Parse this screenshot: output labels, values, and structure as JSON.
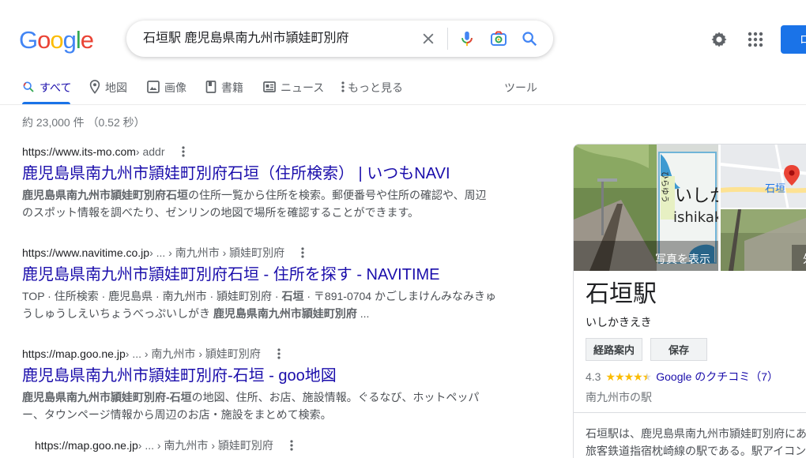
{
  "brand": {
    "logo_letters": [
      "G",
      "o",
      "o",
      "g",
      "l",
      "e"
    ],
    "logo_colors": [
      "#4285F4",
      "#EA4335",
      "#FBBC05",
      "#4285F4",
      "#34A853",
      "#EA4335"
    ]
  },
  "search": {
    "query": "石垣駅 鹿児島県南九州市頴娃町別府",
    "clear_icon": "close-icon",
    "voice_icon": "mic-icon",
    "lens_icon": "camera-icon",
    "search_icon": "search-icon"
  },
  "header": {
    "settings_icon": "gear-icon",
    "apps_icon": "apps-icon",
    "login_label": "ロ"
  },
  "tabs": [
    {
      "label": "すべて",
      "icon": "search-icon",
      "active": true
    },
    {
      "label": "地図",
      "icon": "map-pin-icon"
    },
    {
      "label": "画像",
      "icon": "image-icon"
    },
    {
      "label": "書籍",
      "icon": "book-icon"
    },
    {
      "label": "ニュース",
      "icon": "news-icon"
    },
    {
      "label": "もっと見る",
      "icon": "more-vert-icon"
    },
    {
      "label": "ツール"
    }
  ],
  "stats": "約 23,000 件 （0.52 秒）",
  "results": [
    {
      "url": "https://www.its-mo.com",
      "crumbs": " › addr",
      "title": "鹿児島県南九州市頴娃町別府石垣（住所検索） | いつもNAVI",
      "snippet_bold": "鹿児島県南九州市頴娃町別府石垣",
      "snippet": "の住所一覧から住所を検索。郵便番号や住所の確認や、周辺のスポット情報を調べたり、ゼンリンの地図で場所を確認することができます。"
    },
    {
      "url": "https://www.navitime.co.jp",
      "crumbs": " › ... › 南九州市 › 頴娃町別府",
      "title": "鹿児島県南九州市頴娃町別府石垣 - 住所を探す - NAVITIME",
      "snippet_a": "TOP · 住所検索 · 鹿児島県 · 南九州市 · 頴娃町別府 · ",
      "snippet_bold_a": "石垣",
      "snippet_b": " · 〒891-0704 かごしまけんみなみきゅうしゅうしえいちょうべっぷいしがき ",
      "snippet_bold_b": "鹿児島県南九州市頴娃町別府",
      "snippet_c": " ..."
    },
    {
      "url": "https://map.goo.ne.jp",
      "crumbs": " › ... › 南九州市 › 頴娃町別府",
      "title": "鹿児島県南九州市頴娃町別府-石垣 - goo地図",
      "snippet_bold": "鹿児島県南九州市頴娃町別府-石垣",
      "snippet": "の地図、住所、お店、施設情報。ぐるなび、ホットペッパー、タウンページ情報から周辺のお店・施設をまとめて検索。"
    },
    {
      "url": "https://map.goo.ne.jp",
      "crumbs": " › ... › 南九州市 › 頴娃町別府"
    }
  ],
  "knowledge_panel": {
    "photo_button": "写真を表示",
    "sign_text_top": "いしかき",
    "sign_text_roman": "ishikaki",
    "sign_text_side": "ひらゆう",
    "map_label": "石垣",
    "img3_label": "外",
    "title": "石垣駅",
    "subtitle": "いしかきえき",
    "buttons": [
      "経路案内",
      "保存"
    ],
    "rating": "4.3",
    "stars": "★★★★",
    "reviews_label": "Google のクチコミ（7）",
    "category": "南九州市の駅",
    "description_line1": "石垣駅は、鹿児島県南九州市頴娃町別府にあ",
    "description_line2": "旅客鉄道指宿枕崎線の駅である。駅アイコン"
  }
}
